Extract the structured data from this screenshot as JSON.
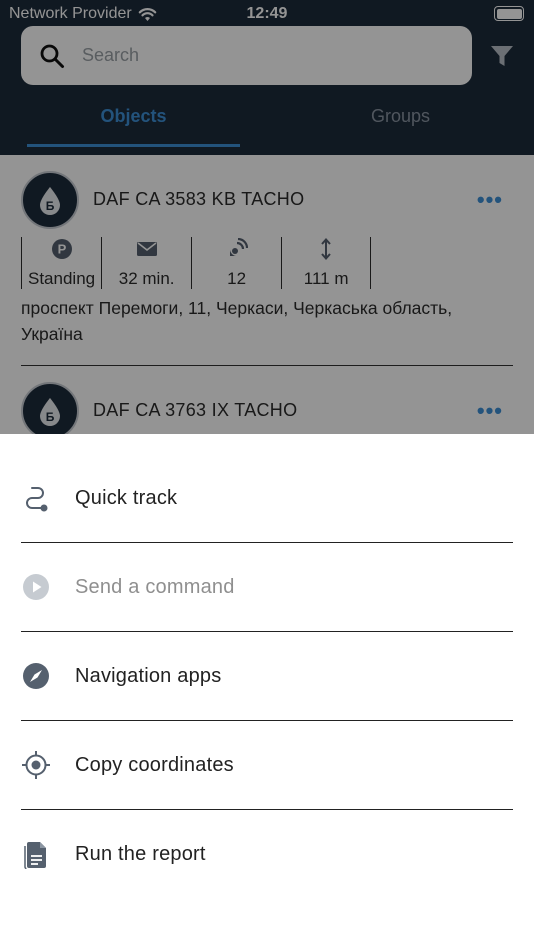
{
  "status_bar": {
    "carrier": "Network Provider",
    "time": "12:49"
  },
  "search": {
    "placeholder": "Search"
  },
  "tabs": [
    {
      "label": "Objects",
      "active": true
    },
    {
      "label": "Groups",
      "active": false
    }
  ],
  "units": [
    {
      "name": "DAF CA 3583 KB TACHO",
      "metrics": {
        "state": "Standing",
        "message_age": "32 min.",
        "satellites": "12",
        "distance": "111 m"
      },
      "address": "проспект Перемоги, 11, Черкаси, Черкаська область, Україна",
      "state_badge": "P"
    },
    {
      "name": "DAF CA 3763 IX TACHO"
    }
  ],
  "actions": [
    {
      "label": "Quick track",
      "icon": "quick-track-icon",
      "enabled": true
    },
    {
      "label": "Send a command",
      "icon": "play-circle-icon",
      "enabled": false
    },
    {
      "label": "Navigation apps",
      "icon": "compass-icon",
      "enabled": true
    },
    {
      "label": "Copy coordinates",
      "icon": "crosshair-icon",
      "enabled": true
    },
    {
      "label": "Run the report",
      "icon": "report-icon",
      "enabled": true
    }
  ],
  "colors": {
    "header_bg": "#1d2b3b",
    "accent": "#3d8fd6",
    "icon_gray": "#55606e",
    "disabled": "#8f8f8f"
  }
}
